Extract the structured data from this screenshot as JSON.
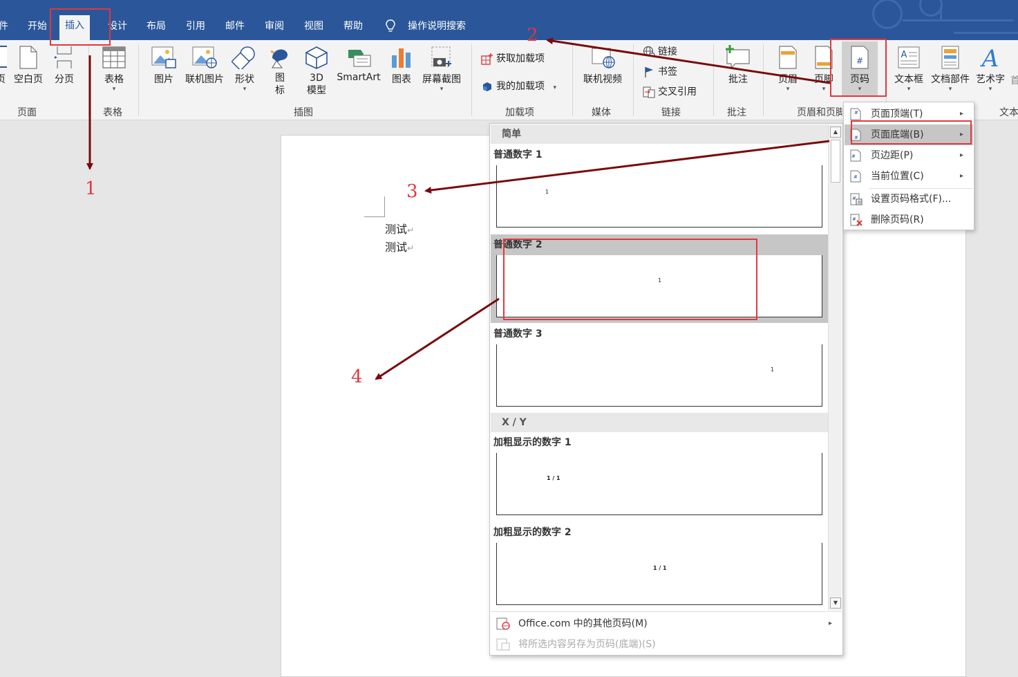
{
  "tabs": [
    {
      "label": "件",
      "active": false
    },
    {
      "label": "开始",
      "active": false
    },
    {
      "label": "插入",
      "active": true
    },
    {
      "label": "设计",
      "active": false
    },
    {
      "label": "布局",
      "active": false
    },
    {
      "label": "引用",
      "active": false
    },
    {
      "label": "邮件",
      "active": false
    },
    {
      "label": "审阅",
      "active": false
    },
    {
      "label": "视图",
      "active": false
    },
    {
      "label": "帮助",
      "active": false
    }
  ],
  "tell_me": "操作说明搜索",
  "ribbon": {
    "pages_group": {
      "label": "页面",
      "items": [
        "页",
        "空白页",
        "分页"
      ]
    },
    "table_group": {
      "label": "表格",
      "table": "表格"
    },
    "illustrations_group": {
      "label": "插图",
      "picture": "图片",
      "online_picture": "联机图片",
      "shapes": "形状",
      "icons_line1": "图",
      "icons_line2": "标",
      "model_line1": "3D",
      "model_line2": "模型",
      "smartart": "SmartArt",
      "chart": "图表",
      "screenshot": "屏幕截图"
    },
    "addins_group": {
      "label": "加载项",
      "get_addins": "获取加载项",
      "my_addins": "我的加载项"
    },
    "media_group": {
      "label": "媒体",
      "online_video": "联机视频"
    },
    "links_group": {
      "label": "链接",
      "link": "链接",
      "bookmark": "书签",
      "cross_ref": "交叉引用"
    },
    "comments_group": {
      "label": "批注",
      "comment": "批注"
    },
    "header_footer_group": {
      "label": "页眉和页脚",
      "header": "页眉",
      "footer": "页脚",
      "page_number": "页码"
    },
    "text_group": {
      "label": "文本",
      "textbox": "文本框",
      "quick_parts": "文档部件",
      "wordart": "艺术字",
      "dropcap": "首"
    }
  },
  "document": {
    "lines": [
      "测试",
      "测试"
    ]
  },
  "gallery": {
    "sections": [
      {
        "header": "简单",
        "items": [
          {
            "title": "普通数字 1",
            "sample": "1",
            "align": "left"
          },
          {
            "title": "普通数字 2",
            "sample": "1",
            "align": "center"
          },
          {
            "title": "普通数字 3",
            "sample": "1",
            "align": "right"
          }
        ]
      },
      {
        "header": "X / Y",
        "items": [
          {
            "title": "加粗显示的数字 1",
            "sample": "1 / 1",
            "align": "left"
          },
          {
            "title": "加粗显示的数字 2",
            "sample": "1 / 1",
            "align": "center"
          }
        ]
      }
    ],
    "footer": {
      "more": "Office.com 中的其他页码(M)",
      "save": "将所选内容另存为页码(底端)(S)"
    }
  },
  "submenu": {
    "items": [
      "页面顶端(T)",
      "页面底端(B)",
      "页边距(P)",
      "当前位置(C)",
      "设置页码格式(F)...",
      "删除页码(R)"
    ],
    "highlighted": 1
  },
  "annotations": [
    "1",
    "2",
    "3",
    "4"
  ],
  "colors": {
    "title_bar": "#2b579a",
    "ribbon": "#f3f3f3",
    "annotation_red": "#e0383e",
    "arrow": "#7a0a0a"
  }
}
